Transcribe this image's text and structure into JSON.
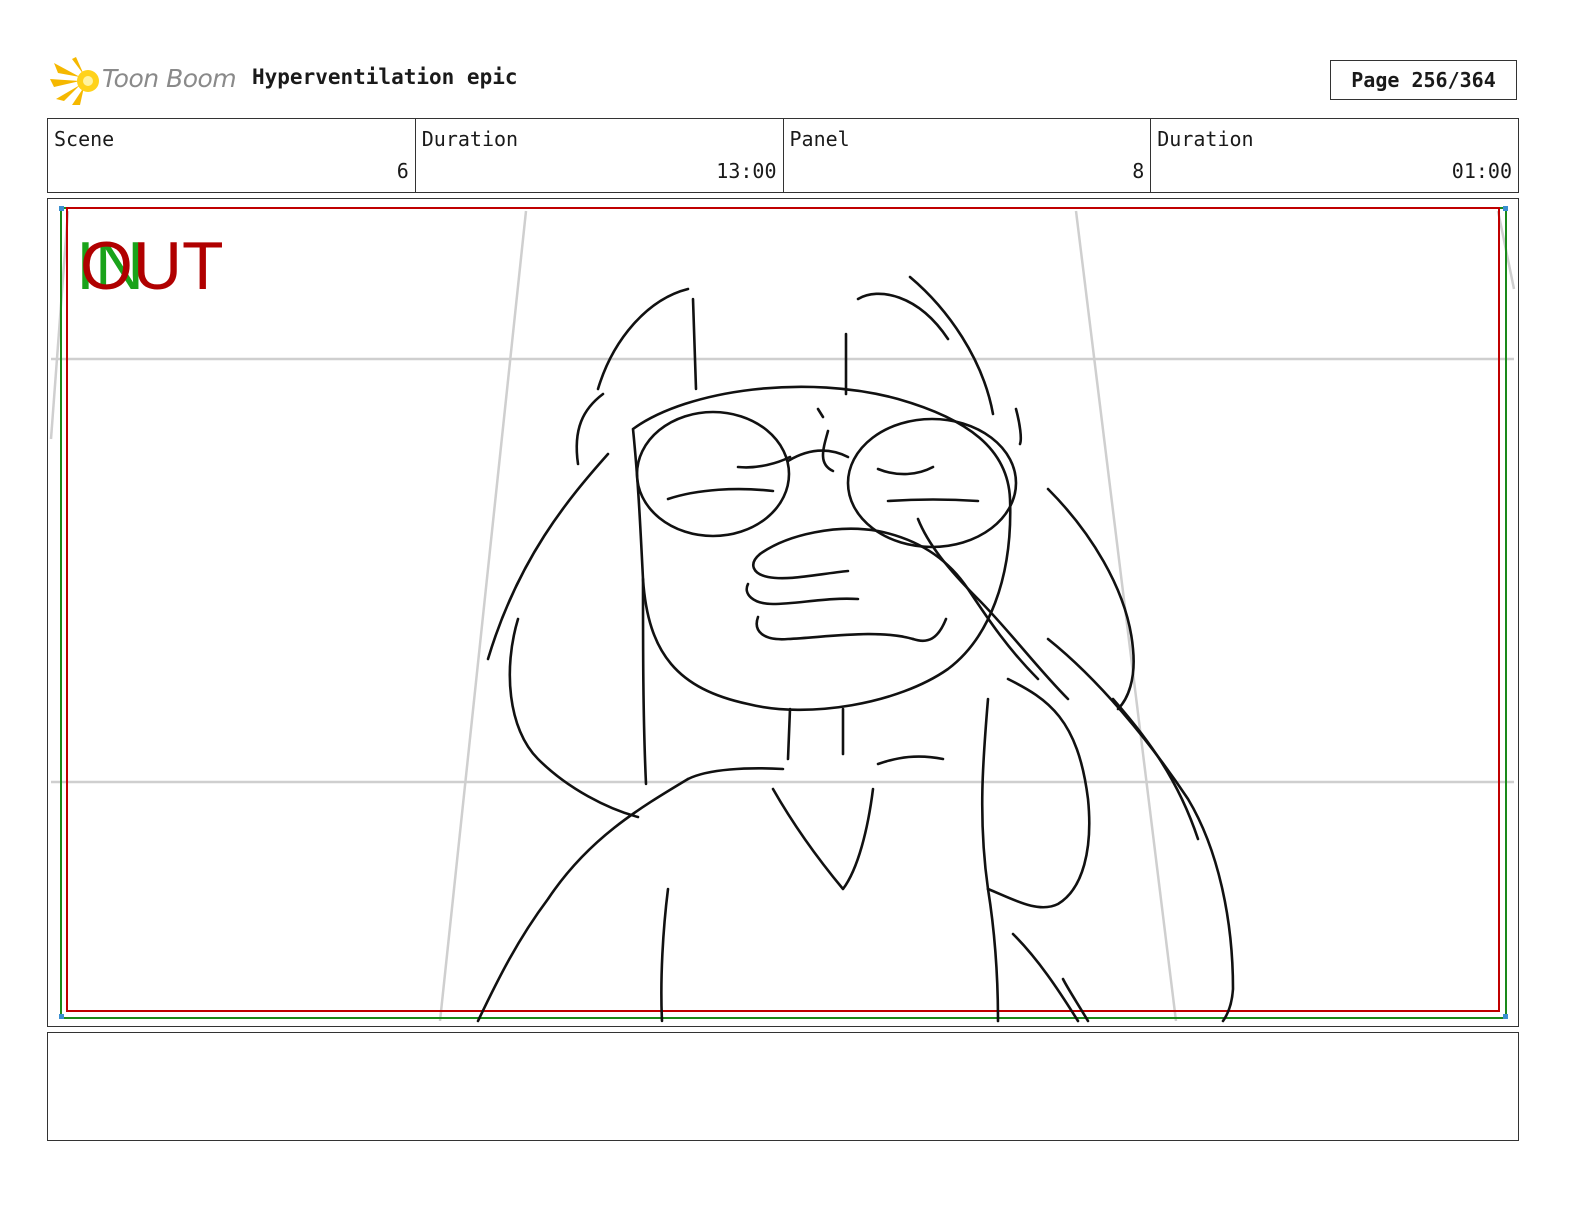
{
  "header": {
    "logo_text": "Toon Boom",
    "project_title": "Hyperventilation epic",
    "page_label": "Page 256/364"
  },
  "info": {
    "scene_label": "Scene",
    "scene_value": "6",
    "scene_duration_label": "Duration",
    "scene_duration_value": "13:00",
    "panel_label": "Panel",
    "panel_value": "8",
    "panel_duration_label": "Duration",
    "panel_duration_value": "01:00"
  },
  "panel": {
    "in_marker": "IN",
    "out_marker": "OUT",
    "colors": {
      "in": "#1aa31a",
      "out": "#b00000",
      "safe_frame_green": "#1a8a1a",
      "safe_frame_red": "#c00000",
      "guide_gray": "#cccccc",
      "sketch": "#111111"
    }
  },
  "notes": {
    "text": ""
  }
}
